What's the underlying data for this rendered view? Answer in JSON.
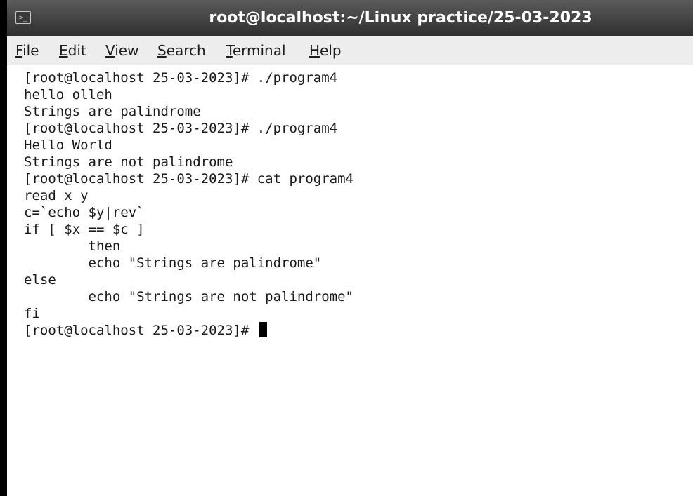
{
  "window": {
    "title": "root@localhost:~/Linux practice/25-03-2023",
    "icon": "terminal-icon"
  },
  "menu": [
    {
      "mnemonic": "F",
      "rest": "ile"
    },
    {
      "mnemonic": "E",
      "rest": "dit"
    },
    {
      "mnemonic": "V",
      "rest": "iew"
    },
    {
      "mnemonic": "S",
      "rest": "earch"
    },
    {
      "mnemonic": "T",
      "rest": "erminal"
    },
    {
      "mnemonic": "H",
      "rest": "elp"
    }
  ],
  "terminal": {
    "lines": [
      "[root@localhost 25-03-2023]# ./program4",
      "hello olleh",
      "Strings are palindrome",
      "[root@localhost 25-03-2023]# ./program4",
      "Hello World",
      "Strings are not palindrome",
      "[root@localhost 25-03-2023]# cat program4",
      "read x y",
      "c=`echo $y|rev`",
      "if [ $x == $c ]",
      "        then",
      "        echo \"Strings are palindrome\"",
      "else",
      "        echo \"Strings are not palindrome\"",
      "fi"
    ],
    "prompt": "[root@localhost 25-03-2023]# "
  }
}
